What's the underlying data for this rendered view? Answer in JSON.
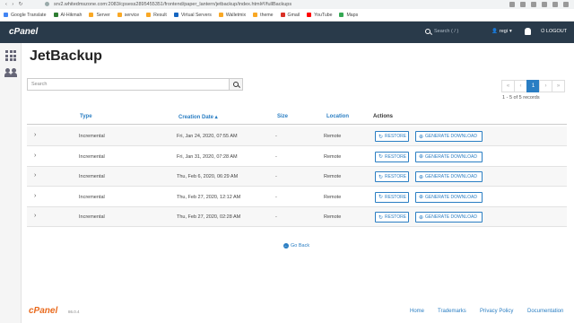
{
  "browser": {
    "nav": "‹ › ↻",
    "url": "srv2.whitedmszone.com:2083/cpsess2895455351/frontend/paper_lantern/jetbackup/index.html#!/fullBackups",
    "bookmarks": [
      {
        "label": "Google Translate",
        "color": "#4285f4"
      },
      {
        "label": "Al-Hikmah",
        "color": "#2e7d32"
      },
      {
        "label": "Server",
        "color": "#f9a825"
      },
      {
        "label": "service",
        "color": "#f9a825"
      },
      {
        "label": "Result",
        "color": "#f9a825"
      },
      {
        "label": "Virtual Servers",
        "color": "#1565c0"
      },
      {
        "label": "Walletmix",
        "color": "#f9a825"
      },
      {
        "label": "theme",
        "color": "#f9a825"
      },
      {
        "label": "Gmail",
        "color": "#d93025"
      },
      {
        "label": "YouTube",
        "color": "#ff0000"
      },
      {
        "label": "Maps",
        "color": "#34a853"
      }
    ]
  },
  "header": {
    "logo": "cPanel",
    "search_placeholder": "Search ( / )",
    "user": "regi",
    "caret": "▾",
    "logout": "LOGOUT"
  },
  "page": {
    "title": "JetBackup",
    "search_placeholder": "Search",
    "pager": [
      "«",
      "‹",
      "1",
      "›",
      "»"
    ],
    "records": "1 - 5 of 5 records"
  },
  "table": {
    "headers": {
      "type": "Type",
      "date": "Creation Date ▴",
      "size": "Size",
      "location": "Location",
      "actions": "Actions"
    },
    "restore_label": "RESTORE",
    "generate_label": "GENERATE DOWNLOAD",
    "rows": [
      {
        "type": "Incremental",
        "date": "Fri, Jan 24, 2020, 07:55 AM",
        "size": "-",
        "location": "Remote"
      },
      {
        "type": "Incremental",
        "date": "Fri, Jan 31, 2020, 07:28 AM",
        "size": "-",
        "location": "Remote"
      },
      {
        "type": "Incremental",
        "date": "Thu, Feb 6, 2020, 06:29 AM",
        "size": "-",
        "location": "Remote"
      },
      {
        "type": "Incremental",
        "date": "Thu, Feb 27, 2020, 12:12 AM",
        "size": "-",
        "location": "Remote"
      },
      {
        "type": "Incremental",
        "date": "Thu, Feb 27, 2020, 02:28 AM",
        "size": "-",
        "location": "Remote"
      }
    ]
  },
  "go_back": "Go Back",
  "footer": {
    "logo": "cPanel",
    "version": "86.0.4",
    "links": [
      "Home",
      "Trademarks",
      "Privacy Policy",
      "Documentation"
    ]
  },
  "colors": {
    "header_bg": "#293a4a",
    "accent": "#2a7ec3",
    "footer_logo": "#e96b1f"
  }
}
